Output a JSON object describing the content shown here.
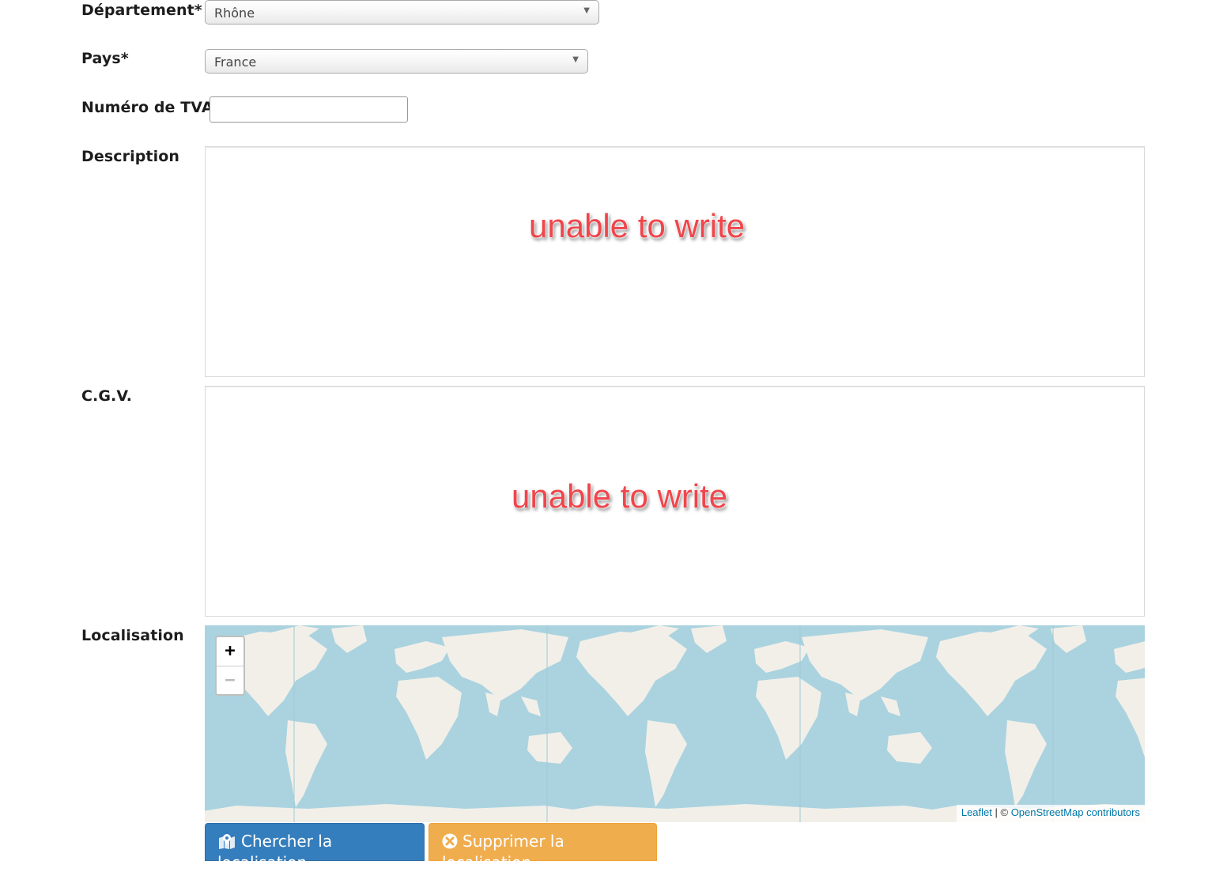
{
  "form": {
    "departement": {
      "label": "Département*",
      "value": "Rhône"
    },
    "pays": {
      "label": "Pays*",
      "value": "France"
    },
    "tva": {
      "label": "Numéro de TVA",
      "value": ""
    },
    "description": {
      "label": "Description",
      "annotation": "unable to write"
    },
    "cgv": {
      "label": "C.G.V.",
      "annotation": "unable to write"
    },
    "localisation": {
      "label": "Localisation"
    }
  },
  "map": {
    "zoom_in": "+",
    "zoom_out": "−",
    "attribution_leaflet": "Leaflet",
    "attribution_sep": " | © ",
    "attribution_osm": "OpenStreetMap contributors",
    "water_color": "#aad3df",
    "land_color": "#f2efe9"
  },
  "buttons": {
    "search": {
      "label": "Chercher la localisation",
      "icon": "map-marker-icon",
      "color": "#357ebd"
    },
    "delete": {
      "label": "Supprimer la localisation",
      "icon": "times-circle-icon",
      "color": "#f0ad4e"
    }
  }
}
